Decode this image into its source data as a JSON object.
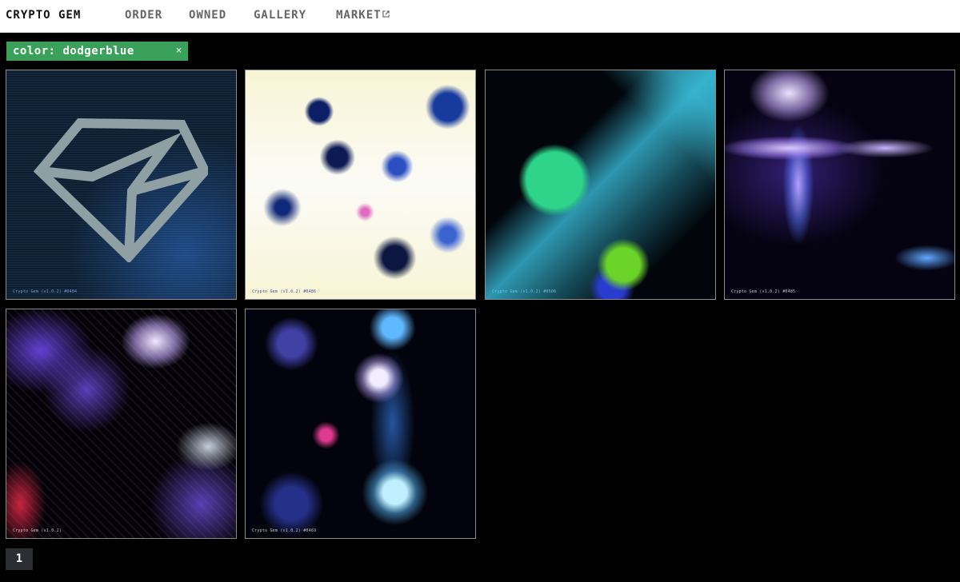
{
  "nav": {
    "brand": "CRYPTO GEM",
    "links": [
      "ORDER",
      "OWNED",
      "GALLERY",
      "MARKET"
    ],
    "market_icon": "external-link-icon"
  },
  "filter": {
    "label": "color: dodgerblue",
    "close": "×",
    "background": "#3aa15a"
  },
  "gallery": {
    "items": [
      {
        "caption": "Crypto Gem (v1.0.2) #0484",
        "palette": [
          "#0d1f33",
          "#1d4a86"
        ],
        "logo": "diamond-icon"
      },
      {
        "caption": "Crypto Gem (v1.0.2) #0486",
        "palette": [
          "#fbfbf6",
          "#0c1f66",
          "#e06ac0"
        ]
      },
      {
        "caption": "Crypto Gem (v1.0.2) #0506",
        "palette": [
          "#02060c",
          "#2dd48a",
          "#46d2f0"
        ]
      },
      {
        "caption": "Crypto Gem (v1.0.2) #0485",
        "palette": [
          "#050312",
          "#ece2ff",
          "#5fa8ff"
        ]
      },
      {
        "caption": "Crypto Gem (v1.0.2)",
        "palette": [
          "#040208",
          "#7846f0",
          "#dc2846"
        ]
      },
      {
        "caption": "Crypto Gem (v1.0.2) #0469",
        "palette": [
          "#03030d",
          "#f1ecff",
          "#e03a8e"
        ]
      }
    ]
  },
  "pagination": {
    "current": "1"
  }
}
